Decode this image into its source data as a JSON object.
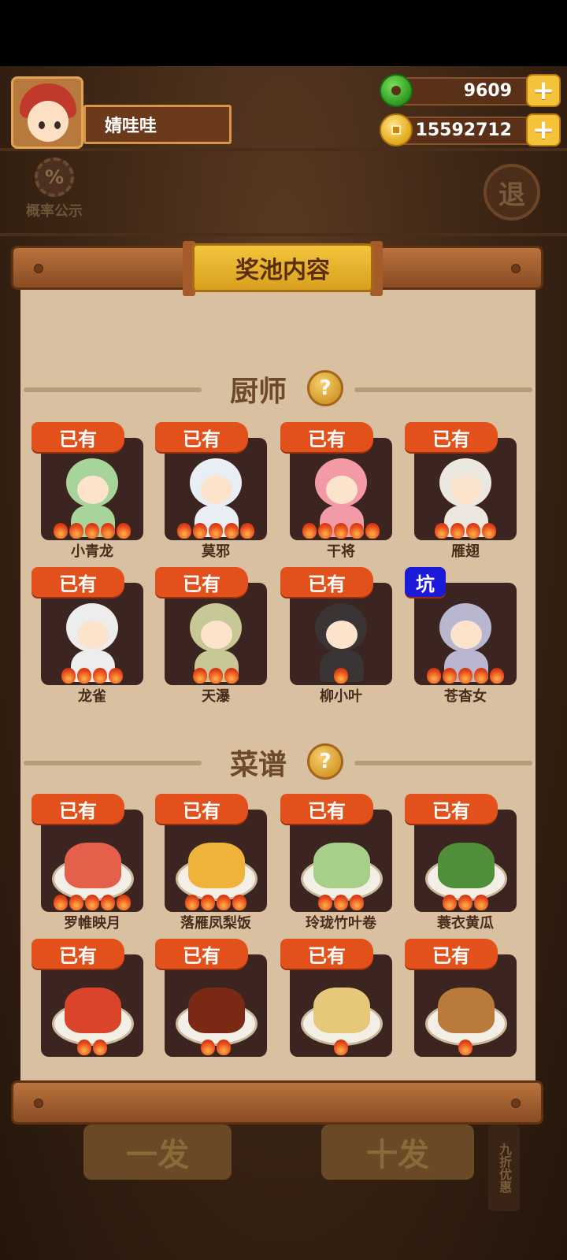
{
  "player": {
    "name": "婧哇哇",
    "avatar_icon": "player-avatar"
  },
  "currencies": {
    "jade": {
      "value": "9609",
      "icon": "jade-icon"
    },
    "gold": {
      "value": "15592712",
      "icon": "coin-icon"
    }
  },
  "probability": {
    "label": "概率公示",
    "icon_text": "%"
  },
  "exit": {
    "label": "退"
  },
  "panel": {
    "title": "奖池内容"
  },
  "chefs": {
    "heading": "厨师",
    "help_label": "?",
    "items": [
      {
        "name": "小青龙",
        "badge": "已有",
        "stars": 5,
        "color": "#a7d49a"
      },
      {
        "name": "莫邪",
        "badge": "已有",
        "stars": 5,
        "color": "#e9eef5"
      },
      {
        "name": "干将",
        "badge": "已有",
        "stars": 5,
        "color": "#f29aa6"
      },
      {
        "name": "雁翅",
        "badge": "已有",
        "stars": 4,
        "color": "#ece7df"
      },
      {
        "name": "龙雀",
        "badge": "已有",
        "stars": 4,
        "color": "#ededed"
      },
      {
        "name": "天瀑",
        "badge": "已有",
        "stars": 3,
        "color": "#c8c896"
      },
      {
        "name": "柳小叶",
        "badge": "已有",
        "stars": 1,
        "color": "#3b3434"
      },
      {
        "name": "苍杳女",
        "badge": "坑",
        "stars": 5,
        "color": "#b9b7cf"
      }
    ]
  },
  "recipes": {
    "heading": "菜谱",
    "help_label": "?",
    "items": [
      {
        "name": "罗帷映月",
        "badge": "已有",
        "stars": 5,
        "color": "#e4604a"
      },
      {
        "name": "落雁凤梨饭",
        "badge": "已有",
        "stars": 4,
        "color": "#f0b33a"
      },
      {
        "name": "玲珑竹叶卷",
        "badge": "已有",
        "stars": 3,
        "color": "#a8cf8a"
      },
      {
        "name": "蓑衣黄瓜",
        "badge": "已有",
        "stars": 3,
        "color": "#4f8f3a"
      },
      {
        "name": "",
        "badge": "已有",
        "stars": 2,
        "color": "#d9442a"
      },
      {
        "name": "",
        "badge": "已有",
        "stars": 2,
        "color": "#7a2a14"
      },
      {
        "name": "",
        "badge": "已有",
        "stars": 1,
        "color": "#e7c87a"
      },
      {
        "name": "",
        "badge": "已有",
        "stars": 1,
        "color": "#b97a3a"
      }
    ]
  },
  "bottom": {
    "single": "一发",
    "ten": "十发",
    "discount": "九折优惠"
  }
}
